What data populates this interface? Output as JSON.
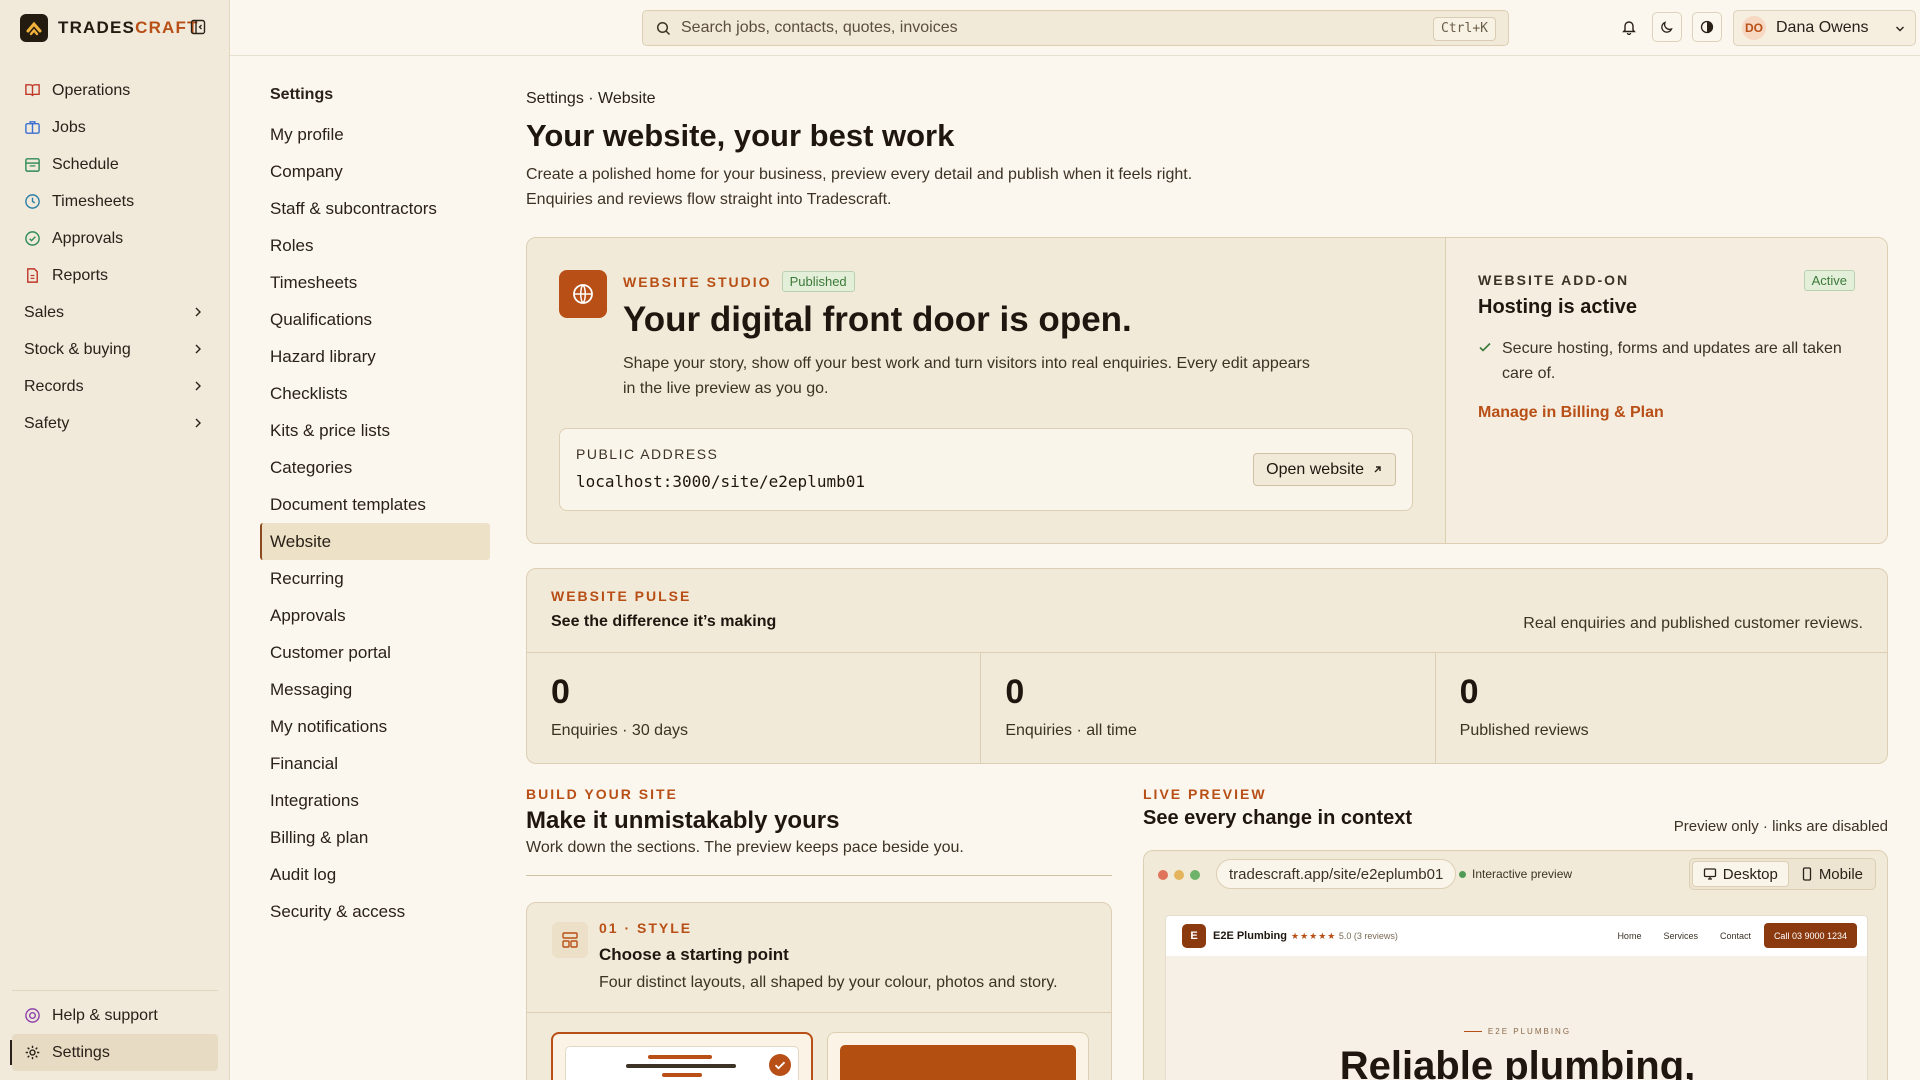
{
  "app": {
    "brand_a": "TRADES",
    "brand_b": "CRAFT",
    "accent": "#b84f16"
  },
  "sidebar": {
    "items": [
      {
        "label": "Operations",
        "icon": "book-icon",
        "color": "#c0392b"
      },
      {
        "label": "Jobs",
        "icon": "briefcase-icon",
        "color": "#3b6fd1"
      },
      {
        "label": "Schedule",
        "icon": "calendar-icon",
        "color": "#2e8b57"
      },
      {
        "label": "Timesheets",
        "icon": "clock-icon",
        "color": "#2b7fa6"
      },
      {
        "label": "Approvals",
        "icon": "check-circle-icon",
        "color": "#2e8b57"
      },
      {
        "label": "Reports",
        "icon": "document-icon",
        "color": "#c0392b"
      }
    ],
    "groups": [
      {
        "label": "Sales"
      },
      {
        "label": "Stock & buying"
      },
      {
        "label": "Records"
      },
      {
        "label": "Safety"
      }
    ],
    "help": "Help & support",
    "settings": "Settings"
  },
  "topbar": {
    "search_placeholder": "Search jobs, contacts, quotes, invoices",
    "shortcut": "Ctrl+K",
    "user_initials": "DO",
    "user_name": "Dana Owens"
  },
  "settings_nav": {
    "title": "Settings",
    "items": [
      "My profile",
      "Company",
      "Staff & subcontractors",
      "Roles",
      "Timesheets",
      "Qualifications",
      "Hazard library",
      "Checklists",
      "Kits & price lists",
      "Categories",
      "Document templates",
      "Website",
      "Recurring",
      "Approvals",
      "Customer portal",
      "Messaging",
      "My notifications",
      "Financial",
      "Integrations",
      "Billing & plan",
      "Audit log",
      "Security & access"
    ],
    "active": "Website"
  },
  "page": {
    "breadcrumb": "Settings · Website",
    "title": "Your website, your best work",
    "subtitle": "Create a polished home for your business, preview every detail and publish when it feels right. Enquiries and reviews flow straight into Tradescraft."
  },
  "studio": {
    "kicker": "WEBSITE STUDIO",
    "badge": "Published",
    "heading": "Your digital front door is open.",
    "text": "Shape your story, show off your best work and turn visitors into real enquiries. Every edit appears in the live preview as you go.",
    "address_label": "PUBLIC ADDRESS",
    "address": "localhost:3000/site/e2eplumb01",
    "open_button": "Open website"
  },
  "addon": {
    "kicker": "WEBSITE ADD-ON",
    "badge": "Active",
    "heading": "Hosting is active",
    "item": "Secure hosting, forms and updates are all taken care of.",
    "link": "Manage in Billing & Plan"
  },
  "pulse": {
    "kicker": "WEBSITE PULSE",
    "heading": "See the difference it’s making",
    "note": "Real enquiries and published customer reviews.",
    "stats": [
      {
        "value": "0",
        "label": "Enquiries · 30 days"
      },
      {
        "value": "0",
        "label": "Enquiries · all time"
      },
      {
        "value": "0",
        "label": "Published reviews"
      }
    ]
  },
  "build": {
    "kicker": "BUILD YOUR SITE",
    "heading": "Make it unmistakably yours",
    "text": "Work down the sections. The preview keeps pace beside you.",
    "step_kicker": "01 · STYLE",
    "step_heading": "Choose a starting point",
    "step_text": "Four distinct layouts, all shaped by your colour, photos and story."
  },
  "preview": {
    "kicker": "LIVE PREVIEW",
    "heading": "See every change in context",
    "note": "Preview only · links are disabled",
    "url": "tradescraft.app/site/e2eplumb01",
    "live_label": "Interactive preview",
    "desktop": "Desktop",
    "mobile": "Mobile",
    "site": {
      "logo": "E",
      "name": "E2E Plumbing",
      "stars": "★★★★★",
      "rating": "5.0",
      "reviews": "(3 reviews)",
      "links": [
        "Home",
        "Services",
        "Contact"
      ],
      "cta": "Call 03 9000 1234",
      "kicker": "E2E PLUMBING",
      "hero": "Reliable plumbing,"
    }
  }
}
